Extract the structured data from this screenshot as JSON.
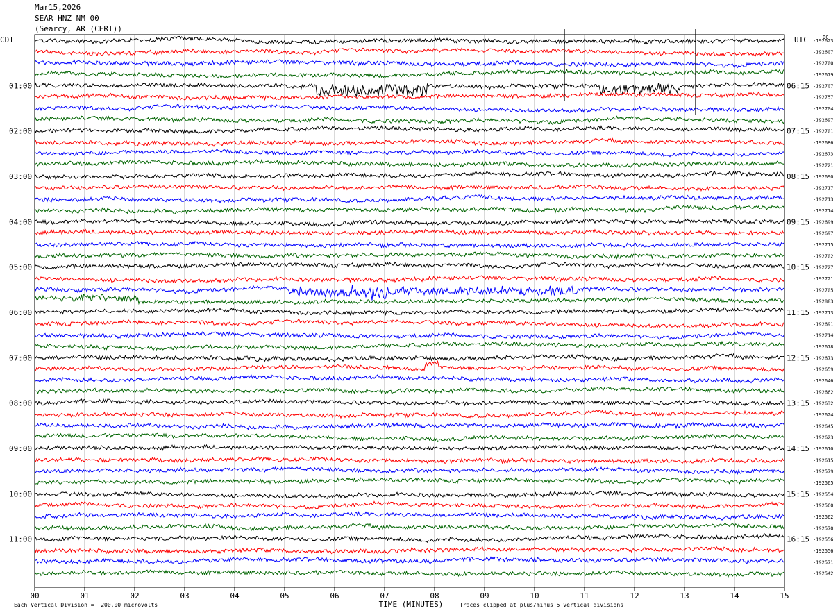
{
  "header": {
    "date": "Mar15,2026",
    "station": "SEAR HNZ NM 00",
    "location": "(Searcy, AR (CERI))"
  },
  "left_tz": "CDT",
  "right_tz": "UTC",
  "dc_label": "DC",
  "footer": {
    "left_note": "Each Vertical Division =  200.00 microvolts",
    "xlabel": "TIME (MINUTES)",
    "right_note": "Traces clipped at plus/minus 5 vertical divisions"
  },
  "colors": {
    "trace_cycle": [
      "#000000",
      "#ff0000",
      "#0000ff",
      "#006400"
    ],
    "grid": "#808080",
    "frame": "#000000",
    "background": "#ffffff"
  },
  "chart_data": {
    "type": "helicorder",
    "x_range_minutes": [
      0,
      15
    ],
    "x_ticks": [
      "00",
      "01",
      "02",
      "03",
      "04",
      "05",
      "06",
      "07",
      "08",
      "09",
      "10",
      "11",
      "12",
      "13",
      "14",
      "15"
    ],
    "xlabel": "TIME (MINUTES)",
    "left_hour_labels": [
      "01:00",
      "02:00",
      "03:00",
      "04:00",
      "05:00",
      "06:00",
      "07:00",
      "08:00",
      "09:00",
      "10:00",
      "11:00"
    ],
    "right_hour_labels": [
      "06:15",
      "07:15",
      "08:15",
      "09:15",
      "10:15",
      "11:15",
      "12:15",
      "13:15",
      "14:15",
      "15:15",
      "16:15"
    ],
    "dc_offsets": [
      -192623,
      -192607,
      -192700,
      -192679,
      -192707,
      -192757,
      -192704,
      -192697,
      -192701,
      -192686,
      -192673,
      -192721,
      -192690,
      -192717,
      -192713,
      -192714,
      -192699,
      -192697,
      -192715,
      -192702,
      -192727,
      -192721,
      -192705,
      -192883,
      -192713,
      -192691,
      -192714,
      -192678,
      -192673,
      -192659,
      -192646,
      -192662,
      -192632,
      -192624,
      -192645,
      -192623,
      -192610,
      -192615,
      -192579,
      -192565,
      -192554,
      -192560,
      -192562,
      -192570,
      -192556,
      -192556,
      -192571,
      -192542
    ],
    "trace_count": 48,
    "minutes_per_trace": 15,
    "microvolts_per_division": 200,
    "clip_divisions": 5
  }
}
